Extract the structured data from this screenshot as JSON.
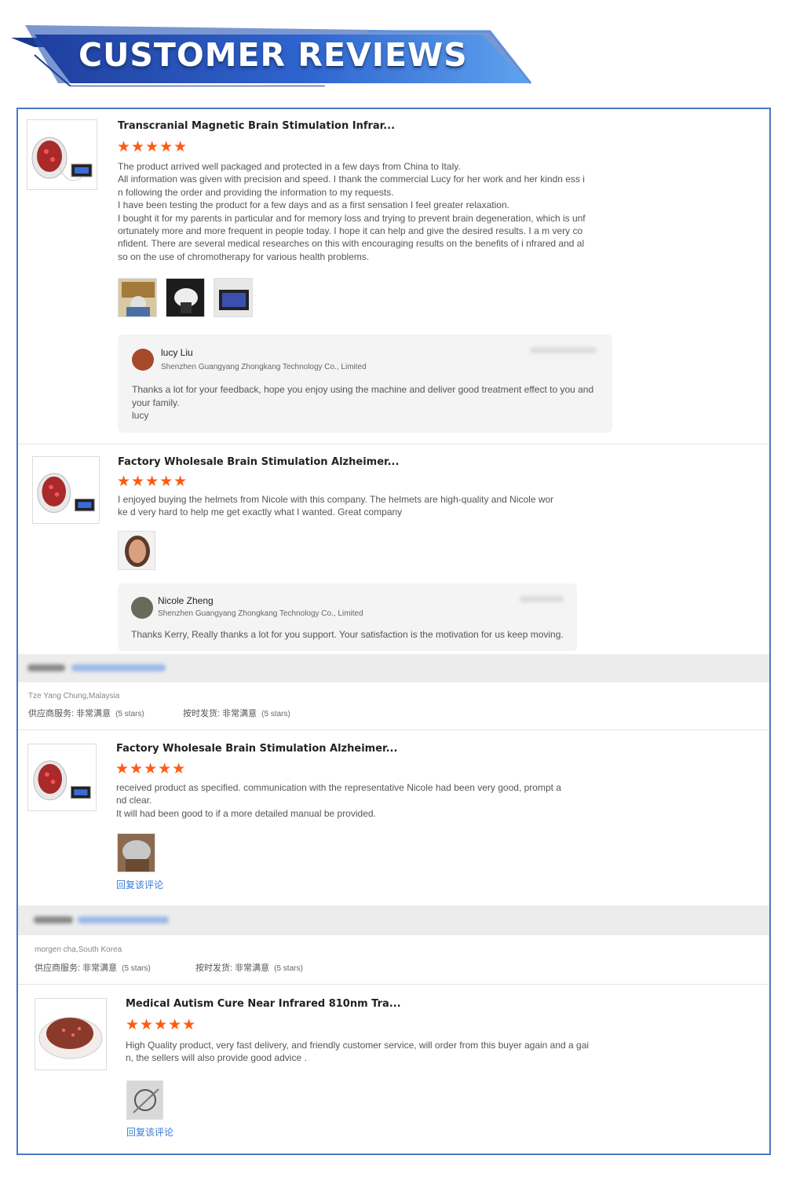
{
  "banner": {
    "title": "CUSTOMER REVIEWS"
  },
  "reviews": [
    {
      "title": "Transcranial Magnetic Brain Stimulation Infrar...",
      "stars": "★★★★★",
      "text": "The product arrived well packaged and protected in a few days from China to Italy.\nAll information was given with precision and speed. I thank the commercial Lucy for her work and her kindn ess in following the order and providing the information to my requests.\nI have been testing the product for a few days and as a first sensation I feel greater relaxation.\nI bought it for my parents in particular and for memory loss and trying to prevent brain degeneration, which is unfortunately more and more frequent in people today. I hope it can help and give the desired results. I a m very confident. There are several medical researches on this with encouraging results on the benefits of i nfrared and also on the use of chromotherapy for various health problems.",
      "reply": {
        "name": "lucy Liu",
        "company": "Shenzhen Guangyang Zhongkang Technology Co., Limited",
        "text": "Thanks a lot for your feedback, hope you enjoy using the machine and deliver good treatment effect to you and your family.\nlucy"
      }
    },
    {
      "title": "Factory Wholesale Brain Stimulation Alzheimer...",
      "stars": "★★★★★",
      "text": "I enjoyed buying the helmets from Nicole with this company. The helmets are high-quality and Nicole worke d very hard to help me get exactly what I wanted. Great company",
      "reply": {
        "name": "Nicole Zheng",
        "company": "Shenzhen Guangyang Zhongkang Technology Co., Limited",
        "text": "Thanks Kerry, Really thanks a lot for you support. Your satisfaction is the motivation for us keep moving."
      }
    },
    {
      "reviewer": "Tze Yang Chung,Malaysia",
      "service_label": "供应商服务: 非常满意",
      "service_stars": "(5 stars)",
      "delivery_label": "按时发货: 非常满意",
      "delivery_stars": "(5 stars)",
      "title": "Factory Wholesale Brain Stimulation Alzheimer...",
      "stars": "★★★★★",
      "text": "received product as specified. communication with the representative Nicole had been very good, prompt a nd clear.\nIt will had been good to if a more detailed manual be provided.",
      "reply_link": "回复该评论"
    },
    {
      "reviewer": "morgen cha,South Korea",
      "service_label": "供应商服务: 非常满意",
      "service_stars": "(5 stars)",
      "delivery_label": "按时发货: 非常满意",
      "delivery_stars": "(5 stars)",
      "title": "Medical Autism Cure Near Infrared 810nm Tra...",
      "stars": "★★★★★",
      "text": "High Quality product, very fast delivery, and friendly customer service, will order from this buyer again and a gain, the sellers will also provide good advice .",
      "reply_link": "回复该评论"
    }
  ],
  "colors": {
    "accent_blue": "#2f5fc0",
    "star_orange": "#ff5a12",
    "link_blue": "#3a7bd5"
  }
}
